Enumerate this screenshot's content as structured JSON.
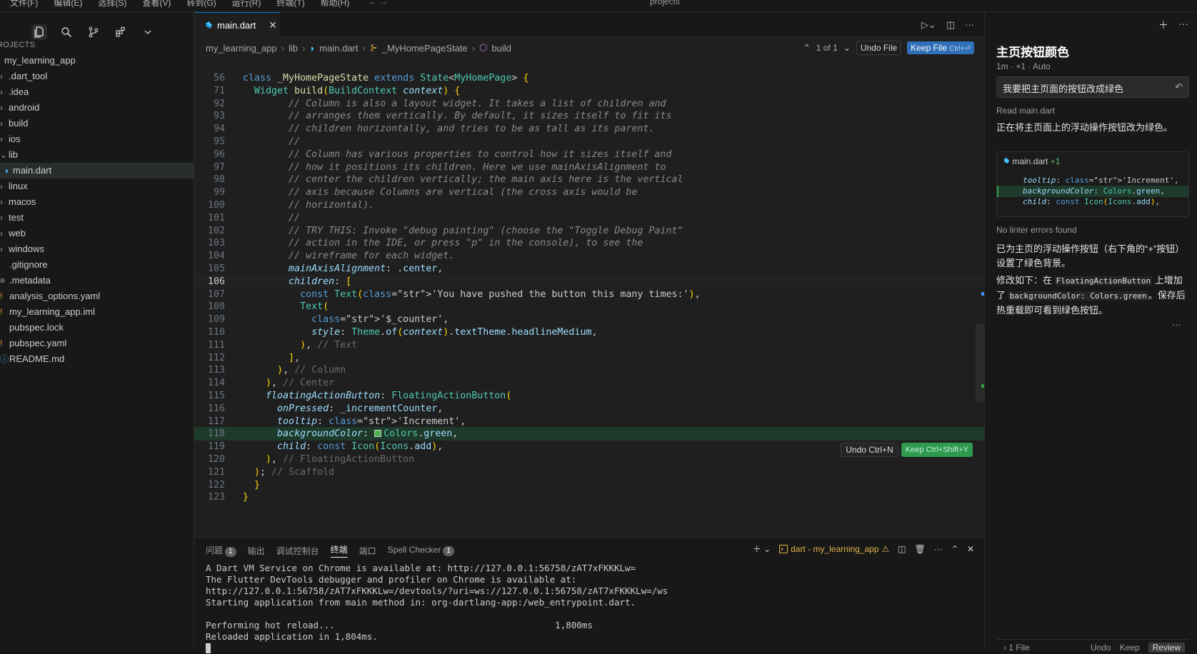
{
  "menubar": {
    "items": [
      "文件(F)",
      "编辑(E)",
      "选择(S)",
      "查看(V)",
      "转到(G)",
      "运行(R)",
      "终端(T)",
      "帮助(H)"
    ],
    "nav": "←  →",
    "title": "projects"
  },
  "explorer": {
    "section": "ROJECTS",
    "root": "my_learning_app",
    "items": [
      {
        "label": ".dart_tool",
        "kind": "folder"
      },
      {
        "label": ".idea",
        "kind": "folder"
      },
      {
        "label": "android",
        "kind": "folder"
      },
      {
        "label": "build",
        "kind": "folder"
      },
      {
        "label": "ios",
        "kind": "folder"
      },
      {
        "label": "lib",
        "kind": "folder-open"
      },
      {
        "label": "main.dart",
        "kind": "dart",
        "selected": true
      },
      {
        "label": "linux",
        "kind": "folder"
      },
      {
        "label": "macos",
        "kind": "folder"
      },
      {
        "label": "test",
        "kind": "folder"
      },
      {
        "label": "web",
        "kind": "folder"
      },
      {
        "label": "windows",
        "kind": "folder"
      },
      {
        "label": ".gitignore",
        "kind": "file"
      },
      {
        "label": ".metadata",
        "kind": "lines"
      },
      {
        "label": "analysis_options.yaml",
        "kind": "yaml"
      },
      {
        "label": "my_learning_app.iml",
        "kind": "iml"
      },
      {
        "label": "pubspec.lock",
        "kind": "file"
      },
      {
        "label": "pubspec.yaml",
        "kind": "yaml"
      },
      {
        "label": "README.md",
        "kind": "info"
      }
    ]
  },
  "editor": {
    "tab": "main.dart",
    "breadcrumbs": [
      "my_learning_app",
      "lib",
      "main.dart",
      "_MyHomePageState",
      "build"
    ],
    "diff_count": "1 of 1",
    "undo_file": "Undo File",
    "keep_file": "Keep File",
    "keep_file_key": "Ctrl+⏎",
    "inline_undo": "Undo",
    "inline_undo_key": "Ctrl+N",
    "inline_keep": "Keep",
    "inline_keep_key": "Ctrl+Shift+Y",
    "added_marker": "+",
    "code_lines": [
      {
        "n": "56",
        "t": "class _MyHomePageState extends State<MyHomePage> {"
      },
      {
        "n": "71",
        "t": "  Widget build(BuildContext context) {"
      },
      {
        "n": "92",
        "t": "        // Column is also a layout widget. It takes a list of children and"
      },
      {
        "n": "93",
        "t": "        // arranges them vertically. By default, it sizes itself to fit its"
      },
      {
        "n": "94",
        "t": "        // children horizontally, and tries to be as tall as its parent."
      },
      {
        "n": "95",
        "t": "        //"
      },
      {
        "n": "96",
        "t": "        // Column has various properties to control how it sizes itself and"
      },
      {
        "n": "97",
        "t": "        // how it positions its children. Here we use mainAxisAlignment to"
      },
      {
        "n": "98",
        "t": "        // center the children vertically; the main axis here is the vertical"
      },
      {
        "n": "99",
        "t": "        // axis because Columns are vertical (the cross axis would be"
      },
      {
        "n": "100",
        "t": "        // horizontal)."
      },
      {
        "n": "101",
        "t": "        //"
      },
      {
        "n": "102",
        "t": "        // TRY THIS: Invoke \"debug painting\" (choose the \"Toggle Debug Paint\""
      },
      {
        "n": "103",
        "t": "        // action in the IDE, or press \"p\" in the console), to see the"
      },
      {
        "n": "104",
        "t": "        // wireframe for each widget."
      },
      {
        "n": "105",
        "t": "        mainAxisAlignment: .center,"
      },
      {
        "n": "106",
        "t": "        children: ["
      },
      {
        "n": "107",
        "t": "          const Text('You have pushed the button this many times:'),"
      },
      {
        "n": "108",
        "t": "          Text("
      },
      {
        "n": "109",
        "t": "            '$_counter',"
      },
      {
        "n": "110",
        "t": "            style: Theme.of(context).textTheme.headlineMedium,"
      },
      {
        "n": "111",
        "t": "          ), // Text"
      },
      {
        "n": "112",
        "t": "        ],"
      },
      {
        "n": "113",
        "t": "      ), // Column"
      },
      {
        "n": "114",
        "t": "    ), // Center"
      },
      {
        "n": "115",
        "t": "    floatingActionButton: FloatingActionButton("
      },
      {
        "n": "116",
        "t": "      onPressed: _incrementCounter,"
      },
      {
        "n": "117",
        "t": "      tooltip: 'Increment',"
      },
      {
        "n": "118",
        "t": "      backgroundColor: Colors.green,"
      },
      {
        "n": "119",
        "t": "      child: const Icon(Icons.add),"
      },
      {
        "n": "120",
        "t": "    ), // FloatingActionButton"
      },
      {
        "n": "121",
        "t": "  ); // Scaffold"
      },
      {
        "n": "122",
        "t": "  }"
      },
      {
        "n": "123",
        "t": "}"
      }
    ],
    "swatch_color": "#4caf50"
  },
  "panel": {
    "tabs": [
      {
        "label": "问题",
        "badge": "1"
      },
      {
        "label": "输出"
      },
      {
        "label": "调试控制台"
      },
      {
        "label": "终端",
        "active": true
      },
      {
        "label": "端口"
      },
      {
        "label": "Spell Checker",
        "badge": "1"
      }
    ],
    "terminal_name": "dart - my_learning_app",
    "terminal_lines": [
      "A Dart VM Service on Chrome is available at: http://127.0.0.1:56758/zAT7xFKKKLw=",
      "The Flutter DevTools debugger and profiler on Chrome is available at:",
      "http://127.0.0.1:56758/zAT7xFKKKLw=/devtools/?uri=ws://127.0.0.1:56758/zAT7xFKKKLw=/ws",
      "Starting application from main method in: org-dartlang-app:/web_entrypoint.dart.",
      "",
      "Performing hot reload...                                         1,800ms",
      "Reloaded application in 1,804ms."
    ]
  },
  "chat": {
    "title": "主页按钮颜色",
    "meta": "1m · +1 · Auto",
    "user_message": "我要把主页面的按钮改成绿色",
    "read_label": "Read main.dart",
    "intro": "正在将主页面上的浮动操作按钮改为绿色。",
    "card_file": "main.dart",
    "card_count": "+1",
    "card_lines": [
      {
        "t": "tooltip: 'Increment',",
        "added": false
      },
      {
        "t": "backgroundColor: Colors.green,",
        "added": true
      },
      {
        "t": "child: const Icon(Icons.add),",
        "added": false
      }
    ],
    "lint": "No linter errors found",
    "summary": "已为主页的浮动操作按钮（右下角的“+”按钮）设置了绿色背景。",
    "change_prefix": "修改如下：在 ",
    "change_code1": "FloatingActionButton",
    "change_mid": " 上增加了 ",
    "change_code2": "backgroundColor: Colors.green",
    "change_suffix": "。保存后热重载即可看到绿色按钮。",
    "more": "···",
    "footer_files": "1 File",
    "footer_undo": "Undo",
    "footer_keep": "Keep",
    "footer_review": "Review"
  }
}
